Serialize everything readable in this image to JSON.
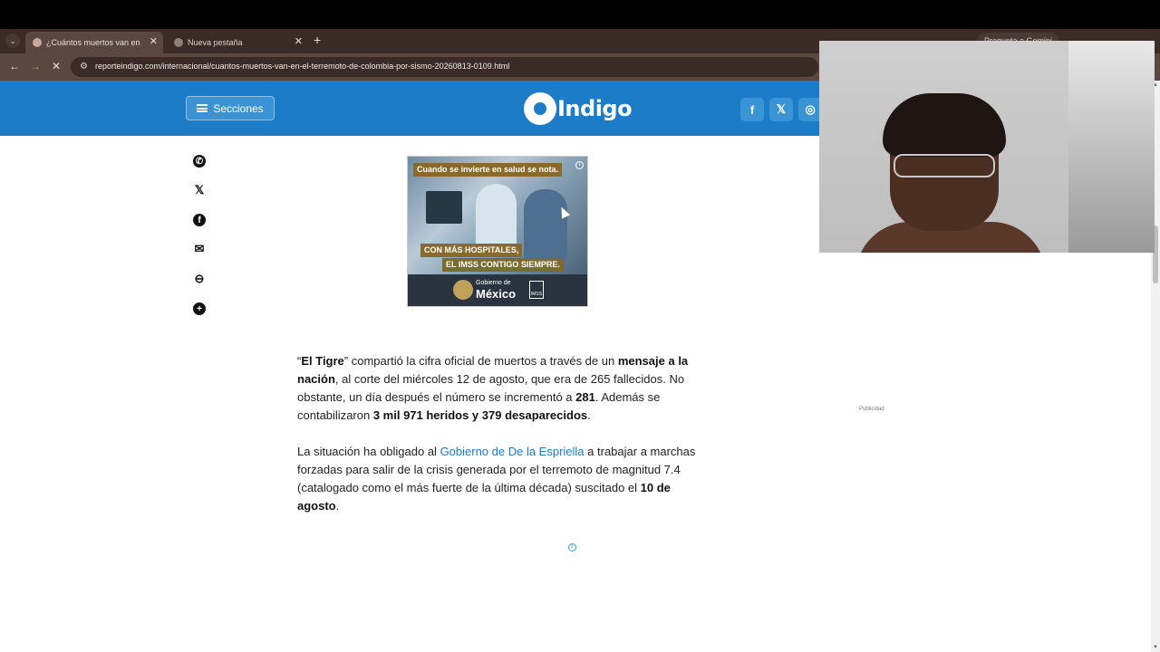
{
  "browser": {
    "tabs": [
      {
        "title": "¿Cuántos muertos van en el terremoto de Colombia por sismo?",
        "active": true
      },
      {
        "title": "Nueva pestaña",
        "active": false
      }
    ],
    "new_tab_icon": "+",
    "close_icon": "✕",
    "gemini_label": "Pregunta a Gemini",
    "url": "reporteindigo.com/internacional/cuantos-muertos-van-en-el-terremoto-de-colombia-por-sismo-20260813-0109.html",
    "icons": {
      "back": "←",
      "forward": "→",
      "stop": "✕",
      "site": "⚙",
      "tab_menu": "⌄"
    }
  },
  "site": {
    "brand_color": "#1d7cc7",
    "sections_label": "Secciones",
    "logo_text": "Indigo",
    "social": [
      {
        "name": "facebook",
        "glyph": "f"
      },
      {
        "name": "x",
        "glyph": "𝕏"
      },
      {
        "name": "instagram",
        "glyph": "◎"
      }
    ]
  },
  "share_icons": [
    "whatsapp-icon",
    "x-icon",
    "facebook-icon",
    "mail-icon",
    "link-icon",
    "plus-icon"
  ],
  "ad": {
    "top_text": "Cuando se invierte en salud se nota.",
    "line1": "CON MÁS HOSPITALES,",
    "line2": "EL IMSS CONTIGO SIEMPRE.",
    "gobierno": "Gobierno de",
    "mexico": "México",
    "imss": "IMSS"
  },
  "article": {
    "p1": {
      "a": "“",
      "b": "El Tigre",
      "c": "” compartió la cifra oficial de muertos a través de un ",
      "d": "mensaje a la nación",
      "e": ", al corte del miércoles 12 de agosto, que era de 265 fallecidos. No obstante, un día después el número se incrementó a ",
      "f": "281",
      "g": ". Además se contabilizaron ",
      "h": "3 mil 971 heridos y 379 desaparecidos",
      "i": "."
    },
    "p2": {
      "a": "La situación ha obligado al ",
      "link": "Gobierno de De la Espriella",
      "b": " a trabajar a marchas forzadas para salir de la crisis generada por el terremoto de magnitud 7.4 (catalogado como el más fuerte de la última década) suscitado el ",
      "c": "10 de agosto",
      "d": "."
    }
  },
  "publicidad_label": "Publicidad",
  "loader_glyph": "①"
}
